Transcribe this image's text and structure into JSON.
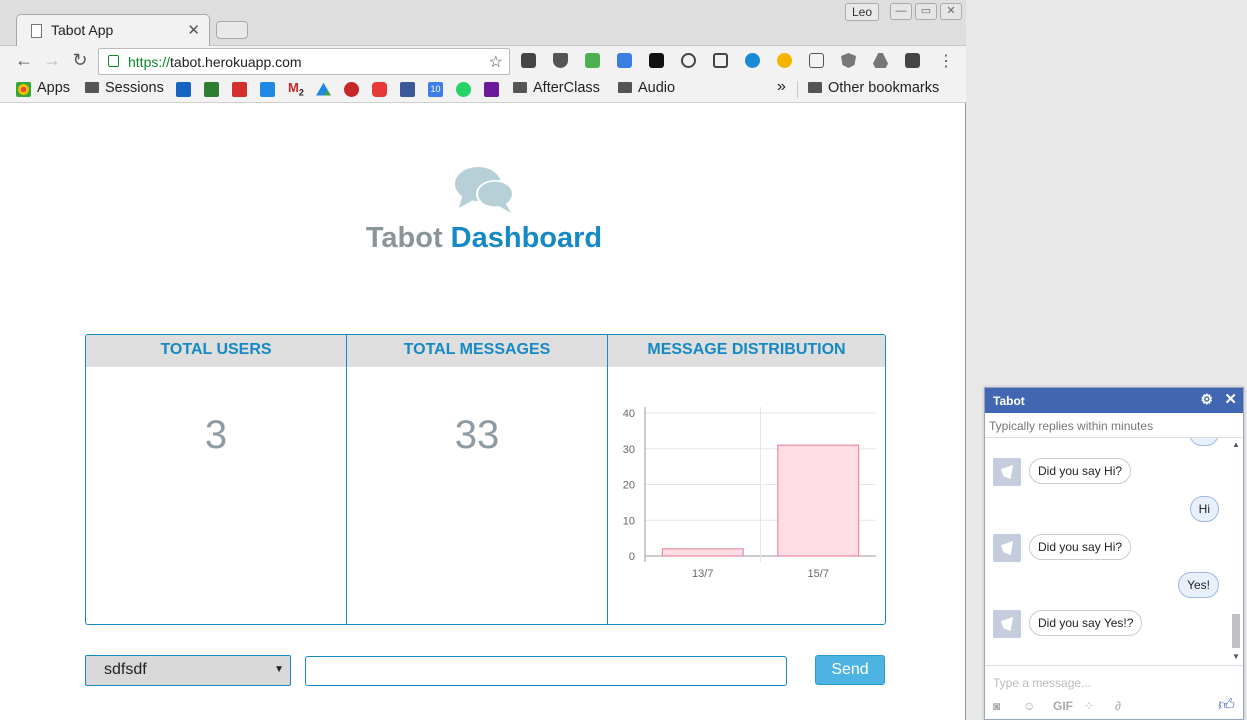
{
  "browser": {
    "tab_title": "Tabot App",
    "profile_name": "Leo",
    "url_scheme": "https://",
    "url_host": "tabot.herokuapp.com",
    "bookmarks": {
      "apps": "Apps",
      "sessions": "Sessions",
      "gmail_count": "2",
      "calendar_day": "10",
      "afterclass": "AfterClass",
      "audio": "Audio",
      "more": "»",
      "other": "Other bookmarks"
    }
  },
  "page": {
    "title_part1": "Tabot",
    "title_part2": "Dashboard",
    "panels": {
      "users_label": "TOTAL USERS",
      "users_value": "3",
      "messages_label": "TOTAL MESSAGES",
      "messages_value": "33",
      "distribution_label": "MESSAGE DISTRIBUTION"
    },
    "select_value": "sdfsdf",
    "input_value": "",
    "send_label": "Send"
  },
  "chart_data": {
    "type": "bar",
    "categories": [
      "13/7",
      "15/7"
    ],
    "values": [
      2,
      31
    ],
    "ylim": [
      0,
      40
    ],
    "yticks": [
      0,
      10,
      20,
      30,
      40
    ],
    "grid": true,
    "colors": {
      "fill": "#ffdde4",
      "stroke": "#e57890"
    }
  },
  "chat": {
    "title": "Tabot",
    "subtitle": "Typically replies within minutes",
    "messages": [
      {
        "from": "bot",
        "text": "Did you say Hi?"
      },
      {
        "from": "user",
        "text": "Hi"
      },
      {
        "from": "bot",
        "text": "Did you say Hi?"
      },
      {
        "from": "user",
        "text": "Yes!"
      },
      {
        "from": "bot",
        "text": "Did you say Yes!?"
      }
    ],
    "input_placeholder": "Type a message...",
    "gif_label": "GIF"
  },
  "colors": {
    "accent": "#1589c3",
    "muted": "#8a9499",
    "messenger": "#4267b2",
    "send_button": "#4db3e2"
  }
}
